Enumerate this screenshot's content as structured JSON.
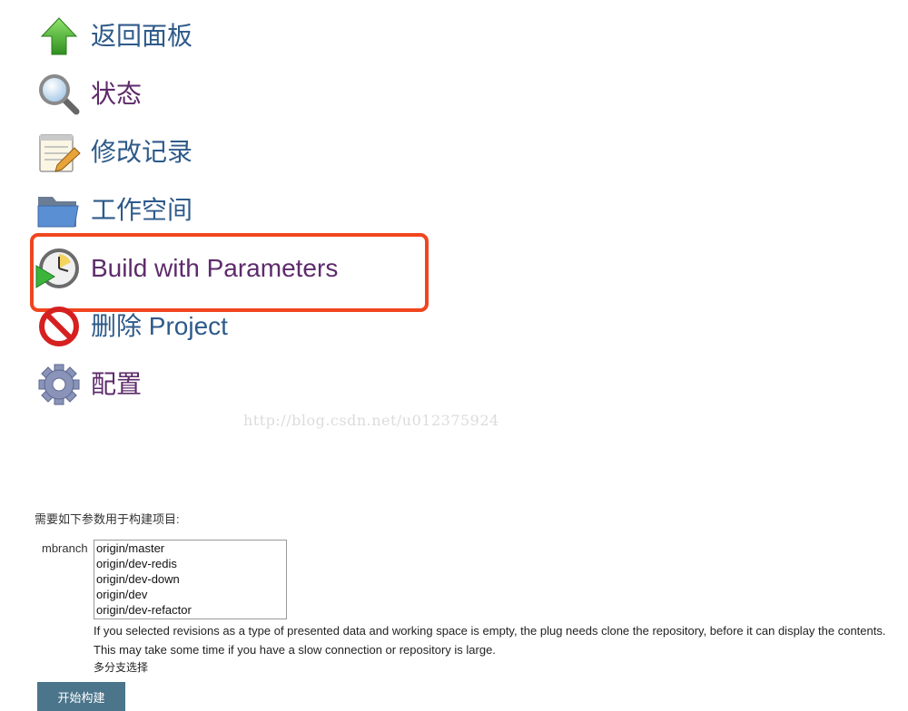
{
  "menu": [
    {
      "label": "返回面板",
      "icon": "up-arrow-icon",
      "color": "#2e5a8a"
    },
    {
      "label": "状态",
      "icon": "magnifier-icon",
      "color": "#5e2b6b"
    },
    {
      "label": "修改记录",
      "icon": "notepad-icon",
      "color": "#2e5a8a"
    },
    {
      "label": "工作空间",
      "icon": "folder-icon",
      "color": "#2e5a8a"
    },
    {
      "label": "Build with Parameters",
      "icon": "clock-play-icon",
      "color": "#5e2b6b"
    },
    {
      "label": "删除 Project",
      "icon": "no-entry-icon",
      "color": "#2e5a8a"
    },
    {
      "label": "配置",
      "icon": "gear-icon",
      "color": "#5e2b6b"
    }
  ],
  "highlight_color": "#f0461e",
  "watermark": "http://blog.csdn.net/u012375924",
  "form": {
    "title": "需要如下参数用于构建项目:",
    "param_name": "mbranch",
    "options": [
      "origin/master",
      "origin/dev-redis",
      "origin/dev-down",
      "origin/dev",
      "origin/dev-refactor"
    ],
    "help": "If you selected revisions as a type of presented data and working space is empty, the plug needs clone the repository, before it can display the contents. This may take some time if you have a slow connection or repository is large.",
    "note": "多分支选择",
    "build_button": "开始构建"
  }
}
